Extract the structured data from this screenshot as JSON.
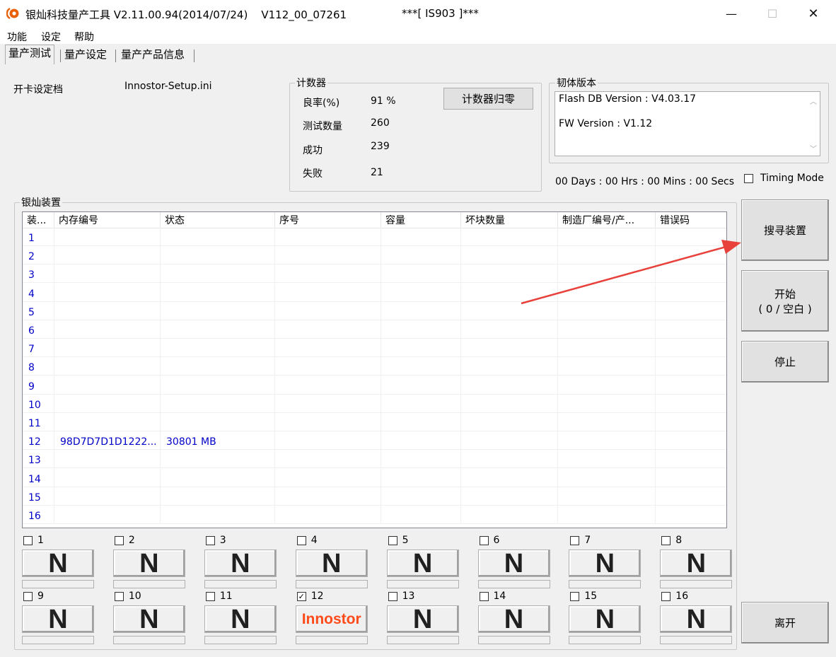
{
  "window": {
    "title": "银灿科技量产工具 V2.11.00.94(2014/07/24)    V112_00_07261",
    "title_mid": "***[ IS903 ]***",
    "minimize_icon": "—",
    "maximize_icon": "☐",
    "close_icon": "✕"
  },
  "menu": [
    "功能",
    "设定",
    "帮助"
  ],
  "tabs": [
    "量产测试",
    "量产设定",
    "量产产品信息"
  ],
  "config": {
    "label": "开卡设定档",
    "file": "Innostor-Setup.ini"
  },
  "counter": {
    "title": "计数器",
    "rows": [
      {
        "label": "良率(%)",
        "value": "91 %"
      },
      {
        "label": "测试数量",
        "value": "260"
      },
      {
        "label": "成功",
        "value": "239"
      },
      {
        "label": "失败",
        "value": "21"
      }
    ],
    "reset_label": "计数器归零"
  },
  "firmware": {
    "title": "韧体版本",
    "flash_db": "Flash DB Version :  V4.03.17",
    "fw": "FW Version :   V1.12",
    "scroll_up": "︿",
    "scroll_down": "﹀"
  },
  "timer": "00 Days : 00 Hrs : 00 Mins : 00 Secs",
  "timing_mode": "Timing Mode",
  "devices": {
    "title": "银灿装置",
    "columns": [
      "装...",
      "内存编号",
      "状态",
      "序号",
      "容量",
      "坏块数量",
      "制造厂编号/产...",
      "错误码"
    ],
    "rows": [
      [
        "1",
        "",
        "",
        "",
        "",
        "",
        "",
        ""
      ],
      [
        "2",
        "",
        "",
        "",
        "",
        "",
        "",
        ""
      ],
      [
        "3",
        "",
        "",
        "",
        "",
        "",
        "",
        ""
      ],
      [
        "4",
        "",
        "",
        "",
        "",
        "",
        "",
        ""
      ],
      [
        "5",
        "",
        "",
        "",
        "",
        "",
        "",
        ""
      ],
      [
        "6",
        "",
        "",
        "",
        "",
        "",
        "",
        ""
      ],
      [
        "7",
        "",
        "",
        "",
        "",
        "",
        "",
        ""
      ],
      [
        "8",
        "",
        "",
        "",
        "",
        "",
        "",
        ""
      ],
      [
        "9",
        "",
        "",
        "",
        "",
        "",
        "",
        ""
      ],
      [
        "10",
        "",
        "",
        "",
        "",
        "",
        "",
        ""
      ],
      [
        "11",
        "",
        "",
        "",
        "",
        "",
        "",
        ""
      ],
      [
        "12",
        "98D7D7D1D1222...",
        "30801 MB",
        "",
        "",
        "",
        "",
        ""
      ],
      [
        "13",
        "",
        "",
        "",
        "",
        "",
        "",
        ""
      ],
      [
        "14",
        "",
        "",
        "",
        "",
        "",
        "",
        ""
      ],
      [
        "15",
        "",
        "",
        "",
        "",
        "",
        "",
        ""
      ],
      [
        "16",
        "",
        "",
        "",
        "",
        "",
        "",
        ""
      ]
    ]
  },
  "ports": [
    {
      "num": "1",
      "checked": false,
      "label": "N"
    },
    {
      "num": "2",
      "checked": false,
      "label": "N"
    },
    {
      "num": "3",
      "checked": false,
      "label": "N"
    },
    {
      "num": "4",
      "checked": false,
      "label": "N"
    },
    {
      "num": "5",
      "checked": false,
      "label": "N"
    },
    {
      "num": "6",
      "checked": false,
      "label": "N"
    },
    {
      "num": "7",
      "checked": false,
      "label": "N"
    },
    {
      "num": "8",
      "checked": false,
      "label": "N"
    },
    {
      "num": "9",
      "checked": false,
      "label": "N"
    },
    {
      "num": "10",
      "checked": false,
      "label": "N"
    },
    {
      "num": "11",
      "checked": false,
      "label": "N"
    },
    {
      "num": "12",
      "checked": true,
      "label": "Innostor"
    },
    {
      "num": "13",
      "checked": false,
      "label": "N"
    },
    {
      "num": "14",
      "checked": false,
      "label": "N"
    },
    {
      "num": "15",
      "checked": false,
      "label": "N"
    },
    {
      "num": "16",
      "checked": false,
      "label": "N"
    }
  ],
  "checkmark": "✓",
  "actions": {
    "search": "搜寻装置",
    "start_line1": "开始",
    "start_line2": "( 0 / 空白  )",
    "stop": "停止",
    "exit": "离开"
  },
  "colors": {
    "annotation_arrow": "#e8413b",
    "row_text": "#0000c8",
    "innostor": "#ff4a1a"
  }
}
